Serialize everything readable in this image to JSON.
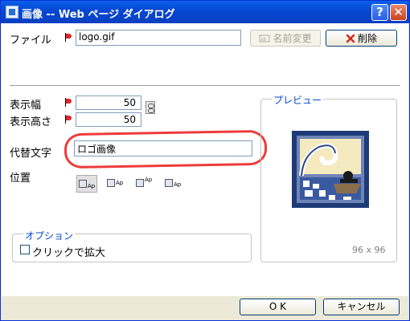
{
  "window": {
    "title": "画像 -- Web ページ ダイアログ",
    "help_glyph": "?",
    "close_glyph": "✕"
  },
  "file": {
    "label": "ファイル",
    "value": "logo.gif",
    "rename_button": "名前変更",
    "delete_button": "削除"
  },
  "size": {
    "width_label": "表示幅",
    "width_value": "50",
    "height_label": "表示高さ",
    "height_value": "50"
  },
  "alt": {
    "label": "代替文字",
    "value": "ロゴ画像"
  },
  "position": {
    "label": "位置",
    "options": [
      {
        "icon": "align-left-icon",
        "text": "Ap"
      },
      {
        "icon": "align-baseline-icon",
        "text": "Ap"
      },
      {
        "icon": "align-top-icon",
        "text": "Ap"
      },
      {
        "icon": "align-bottom-icon",
        "text": "Ap"
      }
    ],
    "selected_index": 0
  },
  "options": {
    "legend": "オプション",
    "click_to_enlarge": "クリックで拡大",
    "click_to_enlarge_checked": false
  },
  "preview": {
    "legend": "プレビュー",
    "size_text": "96 x 96"
  },
  "footer": {
    "ok": "O K",
    "cancel": "キャンセル"
  },
  "colors": {
    "highlight": "#ee3b3b",
    "accent": "#0046d5"
  }
}
